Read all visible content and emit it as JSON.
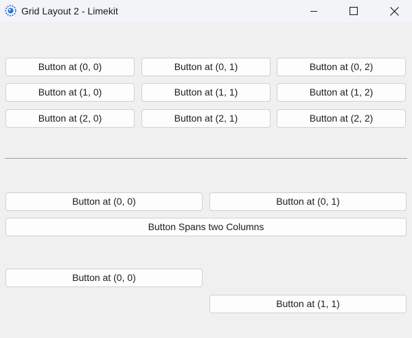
{
  "window": {
    "title": "Grid Layout 2 - Limekit"
  },
  "grid1": {
    "rows": [
      [
        "Button at (0, 0)",
        "Button at (0, 1)",
        "Button at (0, 2)"
      ],
      [
        "Button at (1, 0)",
        "Button at (1, 1)",
        "Button at (1, 2)"
      ],
      [
        "Button at (2, 0)",
        "Button at (2, 1)",
        "Button at (2, 2)"
      ]
    ]
  },
  "grid2": {
    "r0c0": "Button at (0, 0)",
    "r0c1": "Button at (0, 1)",
    "span": "Button Spans two Columns"
  },
  "grid3": {
    "r0c0": "Button at (0, 0)",
    "r1c1": "Button at (1, 1)"
  }
}
